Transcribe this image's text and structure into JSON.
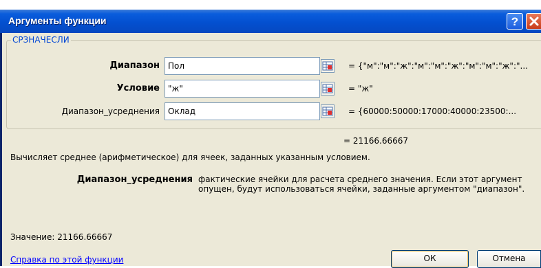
{
  "dialog": {
    "title": "Аргументы функции",
    "function_name": "СРЗНАЧЕСЛИ",
    "arguments": [
      {
        "label": "Диапазон",
        "value": "Пол",
        "result": "= {\"м\":\"м\":\"ж\":\"м\":\"м\":\"ж\":\"м\":\"м\":\"ж\":\"..."
      },
      {
        "label": "Условие",
        "value": "\"ж\"",
        "result": "= \"ж\""
      },
      {
        "label": "Диапазон_усреднения",
        "value": "Оклад",
        "result": "= {60000:50000:17000:40000:23500:..."
      }
    ],
    "formula_result": "= 21166.66667",
    "description": "Вычисляет среднее (арифметическое) для ячеек, заданных указанным условием.",
    "arg_help_name": "Диапазон_усреднения",
    "arg_help_text": "фактические ячейки для расчета среднего значения. Если этот аргумент опущен, будут использоваться ячейки, заданные аргументом \"диапазон\".",
    "value_label": "Значение:",
    "value": "21166.66667",
    "help_link": "Справка по этой функции",
    "ok_label": "ОК",
    "cancel_label": "Отмена",
    "help_button": "?",
    "close_button": "✕"
  },
  "colors": {
    "titlebar": "#0350d0",
    "client_bg": "#ece9d8",
    "legend": "#0046d5",
    "link": "#0000ff"
  }
}
